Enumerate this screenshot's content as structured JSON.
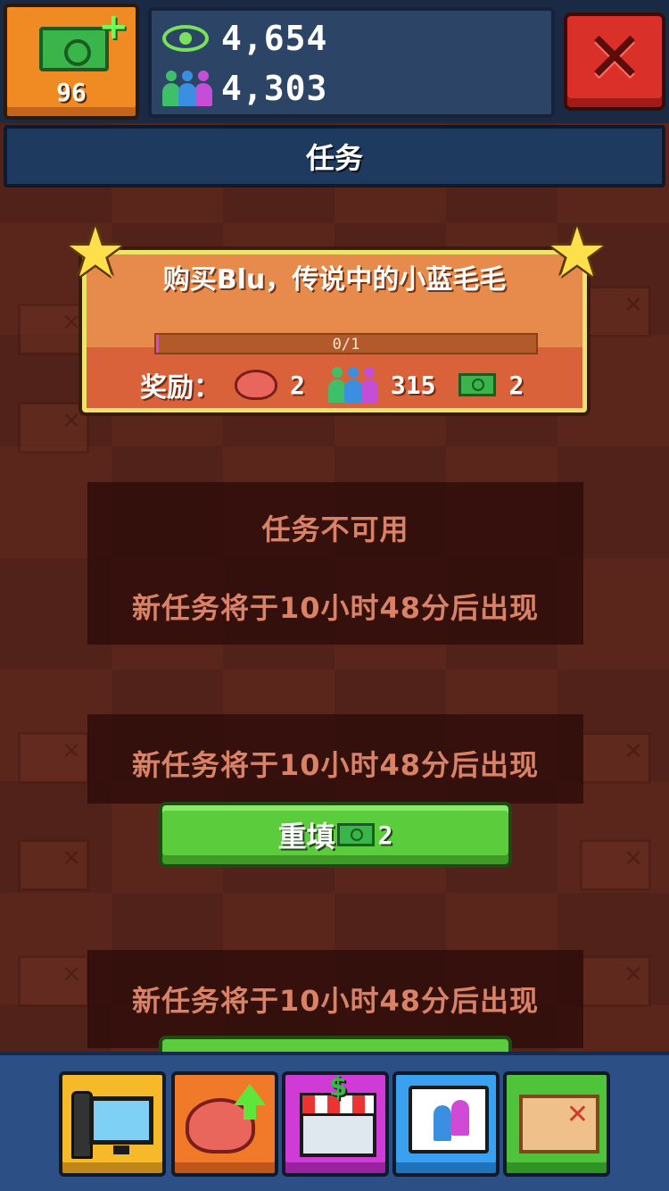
{
  "wallet": {
    "cash": "96",
    "views": "4,654",
    "fans": "4,303"
  },
  "header": {
    "title": "任务"
  },
  "quest": {
    "title": "购买Blu，传说中的小蓝毛毛",
    "progress_text": "0/1",
    "progress_fraction": 0.0,
    "reward_label": "奖励：",
    "rewards": [
      {
        "icon": "brain-icon",
        "amount": "2"
      },
      {
        "icon": "fans-icon",
        "amount": "315"
      },
      {
        "icon": "cash-icon",
        "amount": "2"
      }
    ]
  },
  "slot2": {
    "status": "任务不可用",
    "timer": "新任务将于10小时48分后出现"
  },
  "slot3": {
    "timer": "新任务将于10小时48分后出现",
    "refill_label": "重填",
    "refill_cost": "2"
  },
  "slot4": {
    "timer": "新任务将于10小时48分后出现"
  },
  "nav": {
    "items": [
      {
        "name": "studio",
        "icon": "studio-icon"
      },
      {
        "name": "upgrades",
        "icon": "brain-upgrade-icon"
      },
      {
        "name": "shop",
        "icon": "shop-icon"
      },
      {
        "name": "fans",
        "icon": "fans-chat-icon"
      },
      {
        "name": "quests",
        "icon": "quest-map-icon"
      }
    ]
  },
  "colors": {
    "background": "#5a261c",
    "top_bar": "#1b2a44",
    "close_red": "#d9302a",
    "quest_orange": "#e78b4c",
    "quest_border": "#f0e36a",
    "refill_green": "#5bcc3c",
    "nav_blue": "#2c4f86"
  }
}
